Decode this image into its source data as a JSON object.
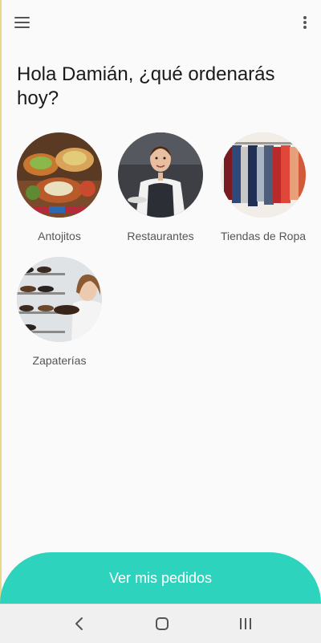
{
  "app_bar": {
    "menu_icon": "hamburger-menu-icon",
    "more_icon": "more-vertical-icon"
  },
  "greeting": "Hola Damián, ¿qué ordenarás hoy?",
  "categories": [
    {
      "label": "Antojitos",
      "image": "mexican-food-platter"
    },
    {
      "label": "Restaurantes",
      "image": "waitress-with-apron"
    },
    {
      "label": "Tiendas de Ropa",
      "image": "clothing-rack"
    },
    {
      "label": "Zapaterías",
      "image": "woman-holding-shoe"
    }
  ],
  "cta": {
    "label": "Ver mis pedidos",
    "color": "#2ed3bd"
  },
  "system_nav": {
    "back_icon": "back-chevron-icon",
    "home_icon": "home-icon",
    "recents_icon": "recent-apps-icon"
  }
}
